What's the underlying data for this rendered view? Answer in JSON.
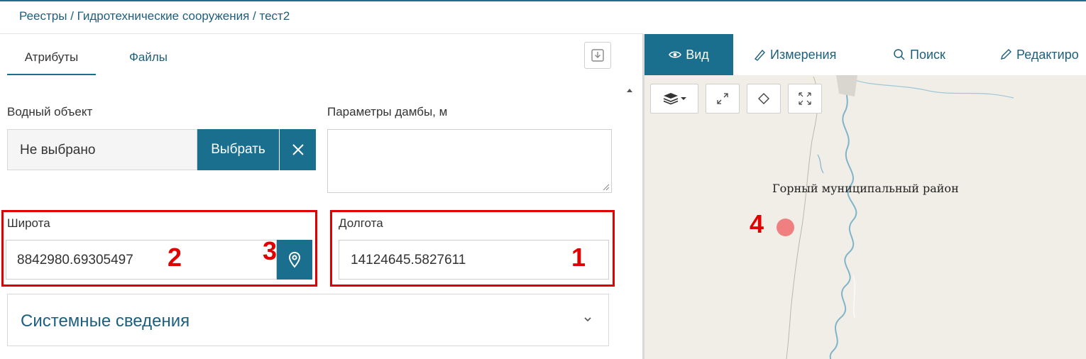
{
  "breadcrumb": {
    "items": [
      "Реестры",
      "Гидротехнические сооружения",
      "тест2"
    ],
    "separator": " / "
  },
  "tabs": [
    {
      "label": "Атрибуты",
      "active": true
    },
    {
      "label": "Файлы",
      "active": false
    }
  ],
  "form": {
    "water_object": {
      "label": "Водный объект",
      "value": "Не выбрано",
      "select_label": "Выбрать"
    },
    "dam_params": {
      "label": "Параметры дамбы, м"
    },
    "latitude": {
      "label": "Широта",
      "value": "8842980.69305497"
    },
    "longitude": {
      "label": "Долгота",
      "value": "14124645.5827611"
    }
  },
  "annotations": {
    "n1": "1",
    "n2": "2",
    "n3": "3",
    "n4": "4"
  },
  "system_panel": {
    "title": "Системные сведения"
  },
  "map": {
    "tabs": [
      {
        "label": "Вид",
        "icon": "eye-icon",
        "active": true
      },
      {
        "label": "Измерения",
        "icon": "ruler-icon",
        "active": false
      },
      {
        "label": "Поиск",
        "icon": "search-icon",
        "active": false
      },
      {
        "label": "Редактиро",
        "icon": "pencil-icon",
        "active": false
      }
    ],
    "region_label": "Горный муниципальный район"
  },
  "colors": {
    "accent": "#1a6e8e",
    "annotation": "#e00000",
    "map_point": "#f08080",
    "river": "#7fb4c9",
    "map_bg": "#f1eee8"
  }
}
